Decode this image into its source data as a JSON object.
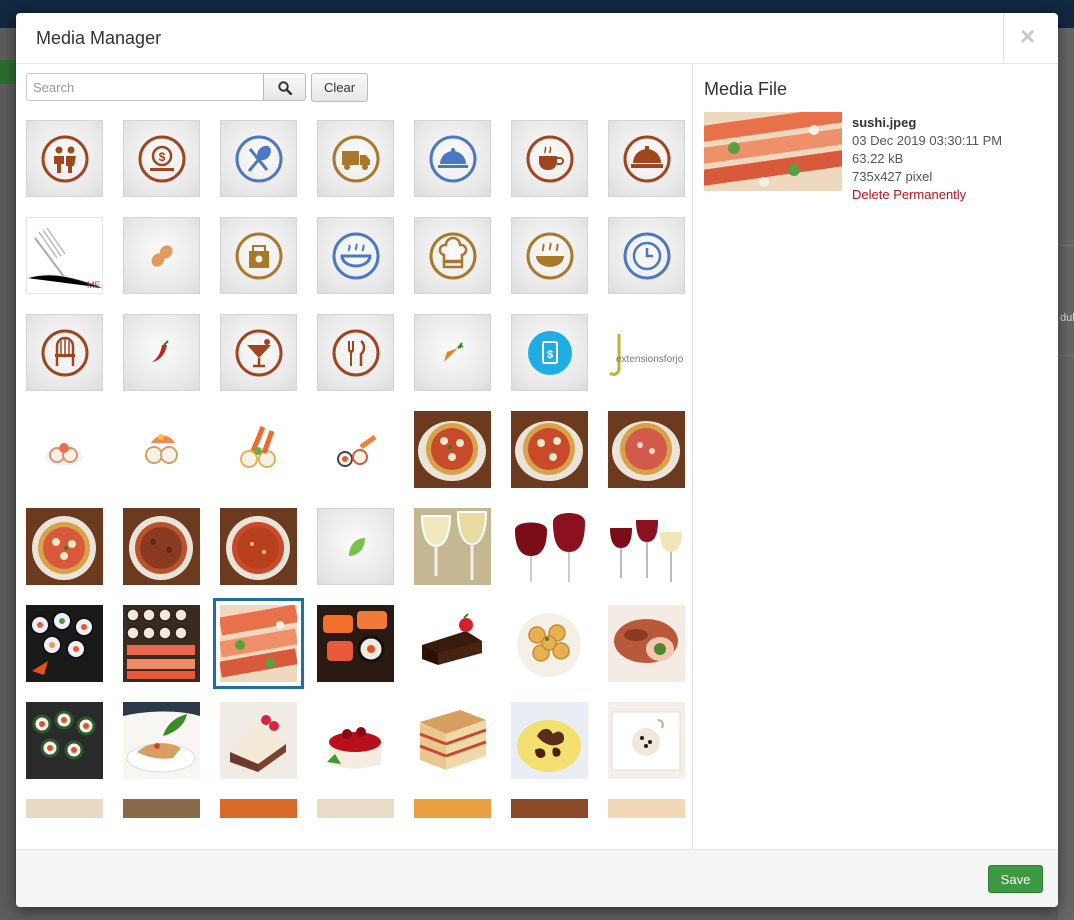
{
  "dialog": {
    "title": "Media Manager",
    "close_label": "×"
  },
  "search": {
    "placeholder": "Search",
    "clear_label": "Clear"
  },
  "details": {
    "heading": "Media File",
    "filename": "sushi.jpeg",
    "date": "03 Dec 2019 03:30:11 PM",
    "size": "63.22 kB",
    "dimensions": "735x427 pixel",
    "delete_label": "Delete Permanently"
  },
  "footer": {
    "save_label": "Save"
  },
  "background": {
    "side_text": "dul"
  },
  "colors": {
    "icon_brown": "#a0461e",
    "icon_blue": "#4a78c2",
    "icon_gold": "#a9782a",
    "selection": "#1d6fa5",
    "save": "#3d9a40",
    "delete": "#b6131d"
  },
  "grid": {
    "rows": [
      [
        "people-icon",
        "coin-icon",
        "utensils-icon",
        "delivery-truck-icon",
        "serving-dome-icon",
        "coffee-cup-icon",
        "cloche-icon"
      ],
      [
        "fork-menu-photo",
        "peanut-icon",
        "takeaway-bag-icon",
        "soup-bowl-icon",
        "chef-hat-icon",
        "hot-bowl-icon",
        "clock-icon"
      ],
      [
        "chair-icon",
        "chili-icon",
        "cocktail-icon",
        "fork-knife-icon",
        "carrot-icon",
        "price-tag-icon",
        "extensionsforjoomla-logo"
      ],
      [
        "sushi-roll-photo",
        "sushi-shrimp-photo",
        "shrimp-tempura-photo",
        "sushi-plate-photo",
        "pizza-photo",
        "pizza-photo",
        "pizza-photo"
      ],
      [
        "pizza-photo",
        "pizza-photo",
        "pizza-photo",
        "leaf-icon",
        "white-wine-photo",
        "red-wine-photo",
        "wine-glasses-photo"
      ],
      [
        "sushi-rolls-photo",
        "sushi-platter-photo",
        "sushi-photo",
        "nigiri-photo",
        "chocolate-cake-photo",
        "tortellini-photo",
        "meat-roll-photo"
      ],
      [
        "sushi-board-photo",
        "fish-dish-photo",
        "raspberry-cake-photo",
        "cheesecake-photo",
        "lasagna-photo",
        "octopus-photo",
        "dessert-plate-photo"
      ],
      [
        "food-photo",
        "food-photo",
        "food-photo",
        "food-photo",
        "food-photo",
        "food-photo",
        "food-photo"
      ]
    ],
    "selected": "sushi.jpeg"
  }
}
